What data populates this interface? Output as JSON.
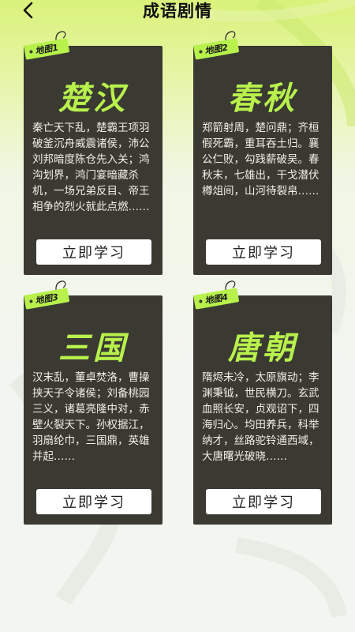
{
  "header": {
    "title": "成语剧情"
  },
  "colors": {
    "card_bg": "#3a3a33",
    "accent": "#b8f04c",
    "text_light": "#f0f0e8"
  },
  "cards": [
    {
      "tag": "地图1",
      "title": "楚汉",
      "description": "秦亡天下乱，楚霸王项羽破釜沉舟威震诸侯，沛公刘邦暗度陈仓先入关；鸿沟划界，鸿门宴暗藏杀机，一场兄弟反目、帝王相争的烈火就此点燃……",
      "button": "立即学习"
    },
    {
      "tag": "地图2",
      "title": "春秋",
      "description": "郑箭射周，楚问鼎；齐桓假死霸，重耳吞土归。襄公仁败，勾践薪破吴。春秋末，七雄出，干戈潜伏樽俎间，山河待裂帛……",
      "button": "立即学习"
    },
    {
      "tag": "地图3",
      "title": "三国",
      "description": "汉末乱，董卓焚洛，曹操挟天子令诸侯；刘备桃园三义，诸葛亮隆中对，赤壁火裂天下。孙权据江，羽扇纶巾，三国鼎，英雄并起……",
      "button": "立即学习"
    },
    {
      "tag": "地图4",
      "title": "唐朝",
      "description": "隋烬未冷，太原旗动；李渊秉钺，世民横刀。玄武血照长安，贞观诏下，四海归心。均田养兵，科举纳才，丝路驼铃通西域，大唐曙光破晓……",
      "button": "立即学习"
    }
  ]
}
